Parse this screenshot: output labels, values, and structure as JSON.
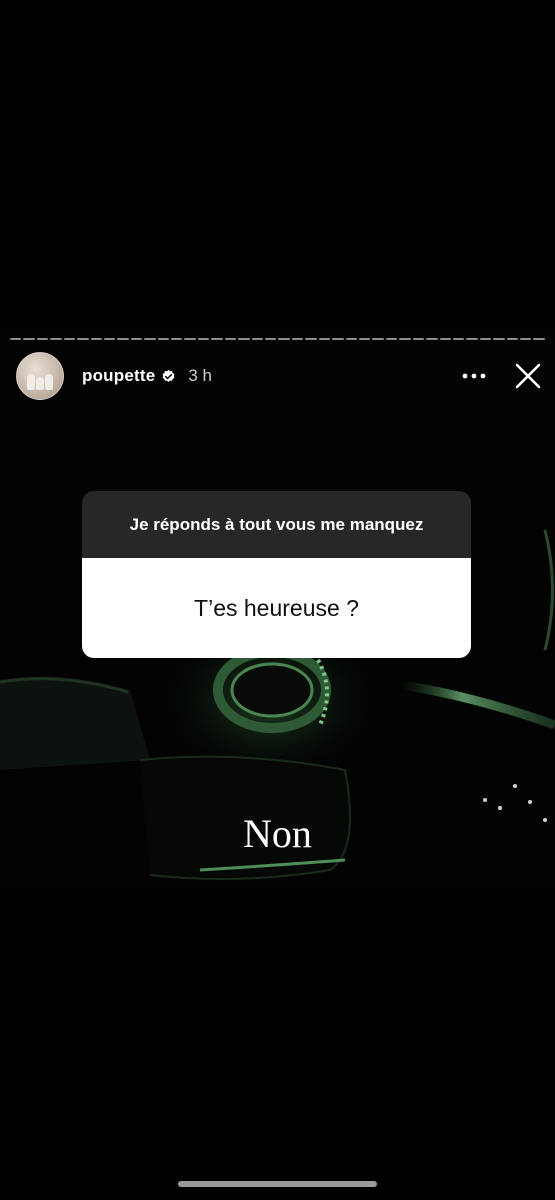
{
  "story": {
    "username": "poupette",
    "timestamp": "3 h",
    "verified": true,
    "progress_segments": 40
  },
  "header": {
    "more_icon": "more-horizontal-icon",
    "close_icon": "close-icon"
  },
  "question_sticker": {
    "prompt": "Je réponds à tout vous me manquez",
    "question": "T’es heureuse ?"
  },
  "reply": {
    "text": "Non"
  },
  "colors": {
    "background": "#000000",
    "sticker_header": "#272729",
    "sticker_body": "#ffffff",
    "ambient_glow": "#5ea86a"
  }
}
